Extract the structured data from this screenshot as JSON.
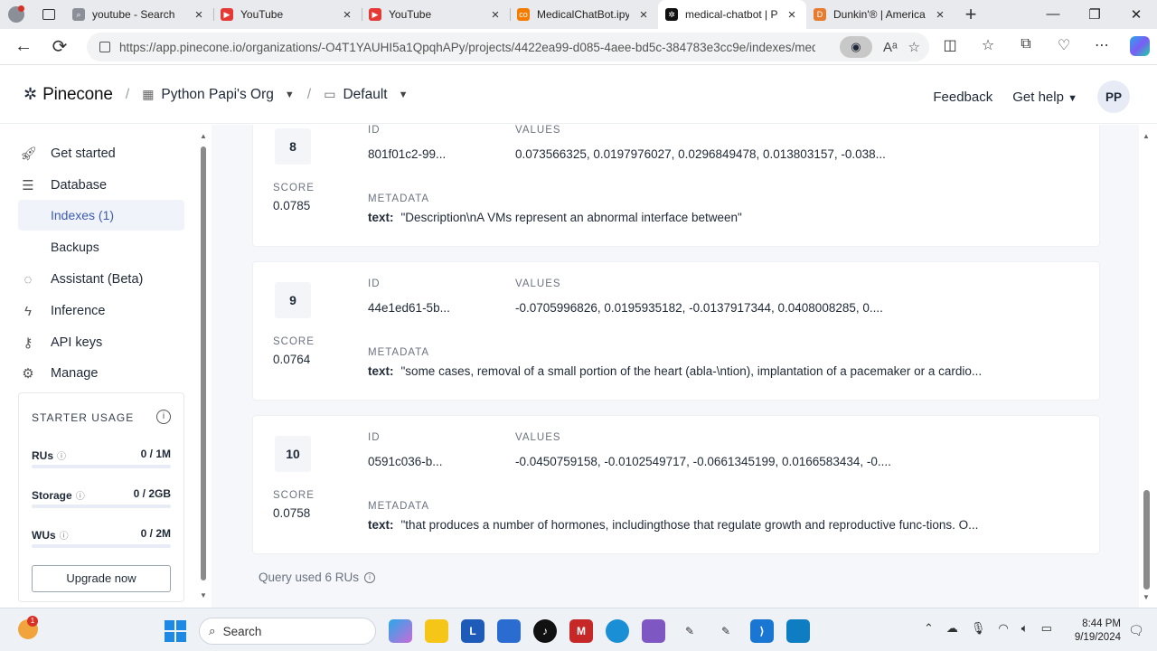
{
  "browser": {
    "tabs": [
      {
        "title": "youtube - Search",
        "icon": "search-icon",
        "color": "#8a8f98"
      },
      {
        "title": "YouTube",
        "icon": "youtube-icon",
        "color": "#e53935"
      },
      {
        "title": "YouTube",
        "icon": "youtube-icon",
        "color": "#e53935"
      },
      {
        "title": "MedicalChatBot.ipynb",
        "icon": "colab-icon",
        "color": "#f57c00"
      },
      {
        "title": "medical-chatbot | Pinecone",
        "icon": "pinecone-icon",
        "color": "#111111"
      },
      {
        "title": "Dunkin'® | America's",
        "icon": "dunkin-icon",
        "color": "#e57c2f"
      }
    ],
    "url": "https://app.pinecone.io/organizations/-O4T1YAUHI5a1QpqhAPy/projects/4422ea99-d085-4aee-bd5c-384783e3cc9e/indexes/medi..."
  },
  "header": {
    "logo": "Pinecone",
    "org": "Python Papi's Org",
    "project": "Default",
    "feedback": "Feedback",
    "help": "Get help",
    "avatar": "PP"
  },
  "sidebar": {
    "items": [
      {
        "label": "Get started",
        "icon": "rocket-icon"
      },
      {
        "label": "Database",
        "icon": "database-icon"
      },
      {
        "label": "Indexes (1)"
      },
      {
        "label": "Backups"
      },
      {
        "label": "Assistant (Beta)",
        "icon": "lightbulb-icon"
      },
      {
        "label": "Inference",
        "icon": "bolt-icon"
      },
      {
        "label": "API keys",
        "icon": "key-icon"
      },
      {
        "label": "Manage",
        "icon": "gear-icon"
      }
    ],
    "usage": {
      "title": "STARTER USAGE",
      "rows": [
        {
          "label": "RUs",
          "value": "0 / 1M",
          "fraction": 0
        },
        {
          "label": "Storage",
          "value": "0 / 2GB",
          "fraction": 0
        },
        {
          "label": "WUs",
          "value": "0 / 2M",
          "fraction": 0
        }
      ],
      "upgrade": "Upgrade now"
    }
  },
  "labels": {
    "id": "ID",
    "values": "VALUES",
    "score": "SCORE",
    "metadata": "METADATA",
    "text": "text:"
  },
  "results": [
    {
      "rank": "8",
      "id": "801f01c2-99...",
      "values": "0.073566325, 0.0197976027, 0.0296849478, 0.013803157, -0.038...",
      "score": "0.0785",
      "text": "\"Description\\nA VMs represent an abnormal interface between\""
    },
    {
      "rank": "9",
      "id": "44e1ed61-5b...",
      "values": "-0.0705996826, 0.0195935182, -0.0137917344, 0.0408008285, 0....",
      "score": "0.0764",
      "text": "\"some cases, removal of a small portion of the heart (abla-\\ntion), implantation of a pacemaker or a cardio..."
    },
    {
      "rank": "10",
      "id": "0591c036-b...",
      "values": "-0.0450759158, -0.0102549717, -0.0661345199, 0.0166583434, -0....",
      "score": "0.0758",
      "text": "\"that produces a number of hormones, includingthose that regulate growth and reproductive func-tions. O..."
    }
  ],
  "footer": "Query used 6 RUs",
  "taskbar": {
    "search": "Search",
    "badge": "1",
    "time": "8:44 PM",
    "date": "9/19/2024"
  }
}
